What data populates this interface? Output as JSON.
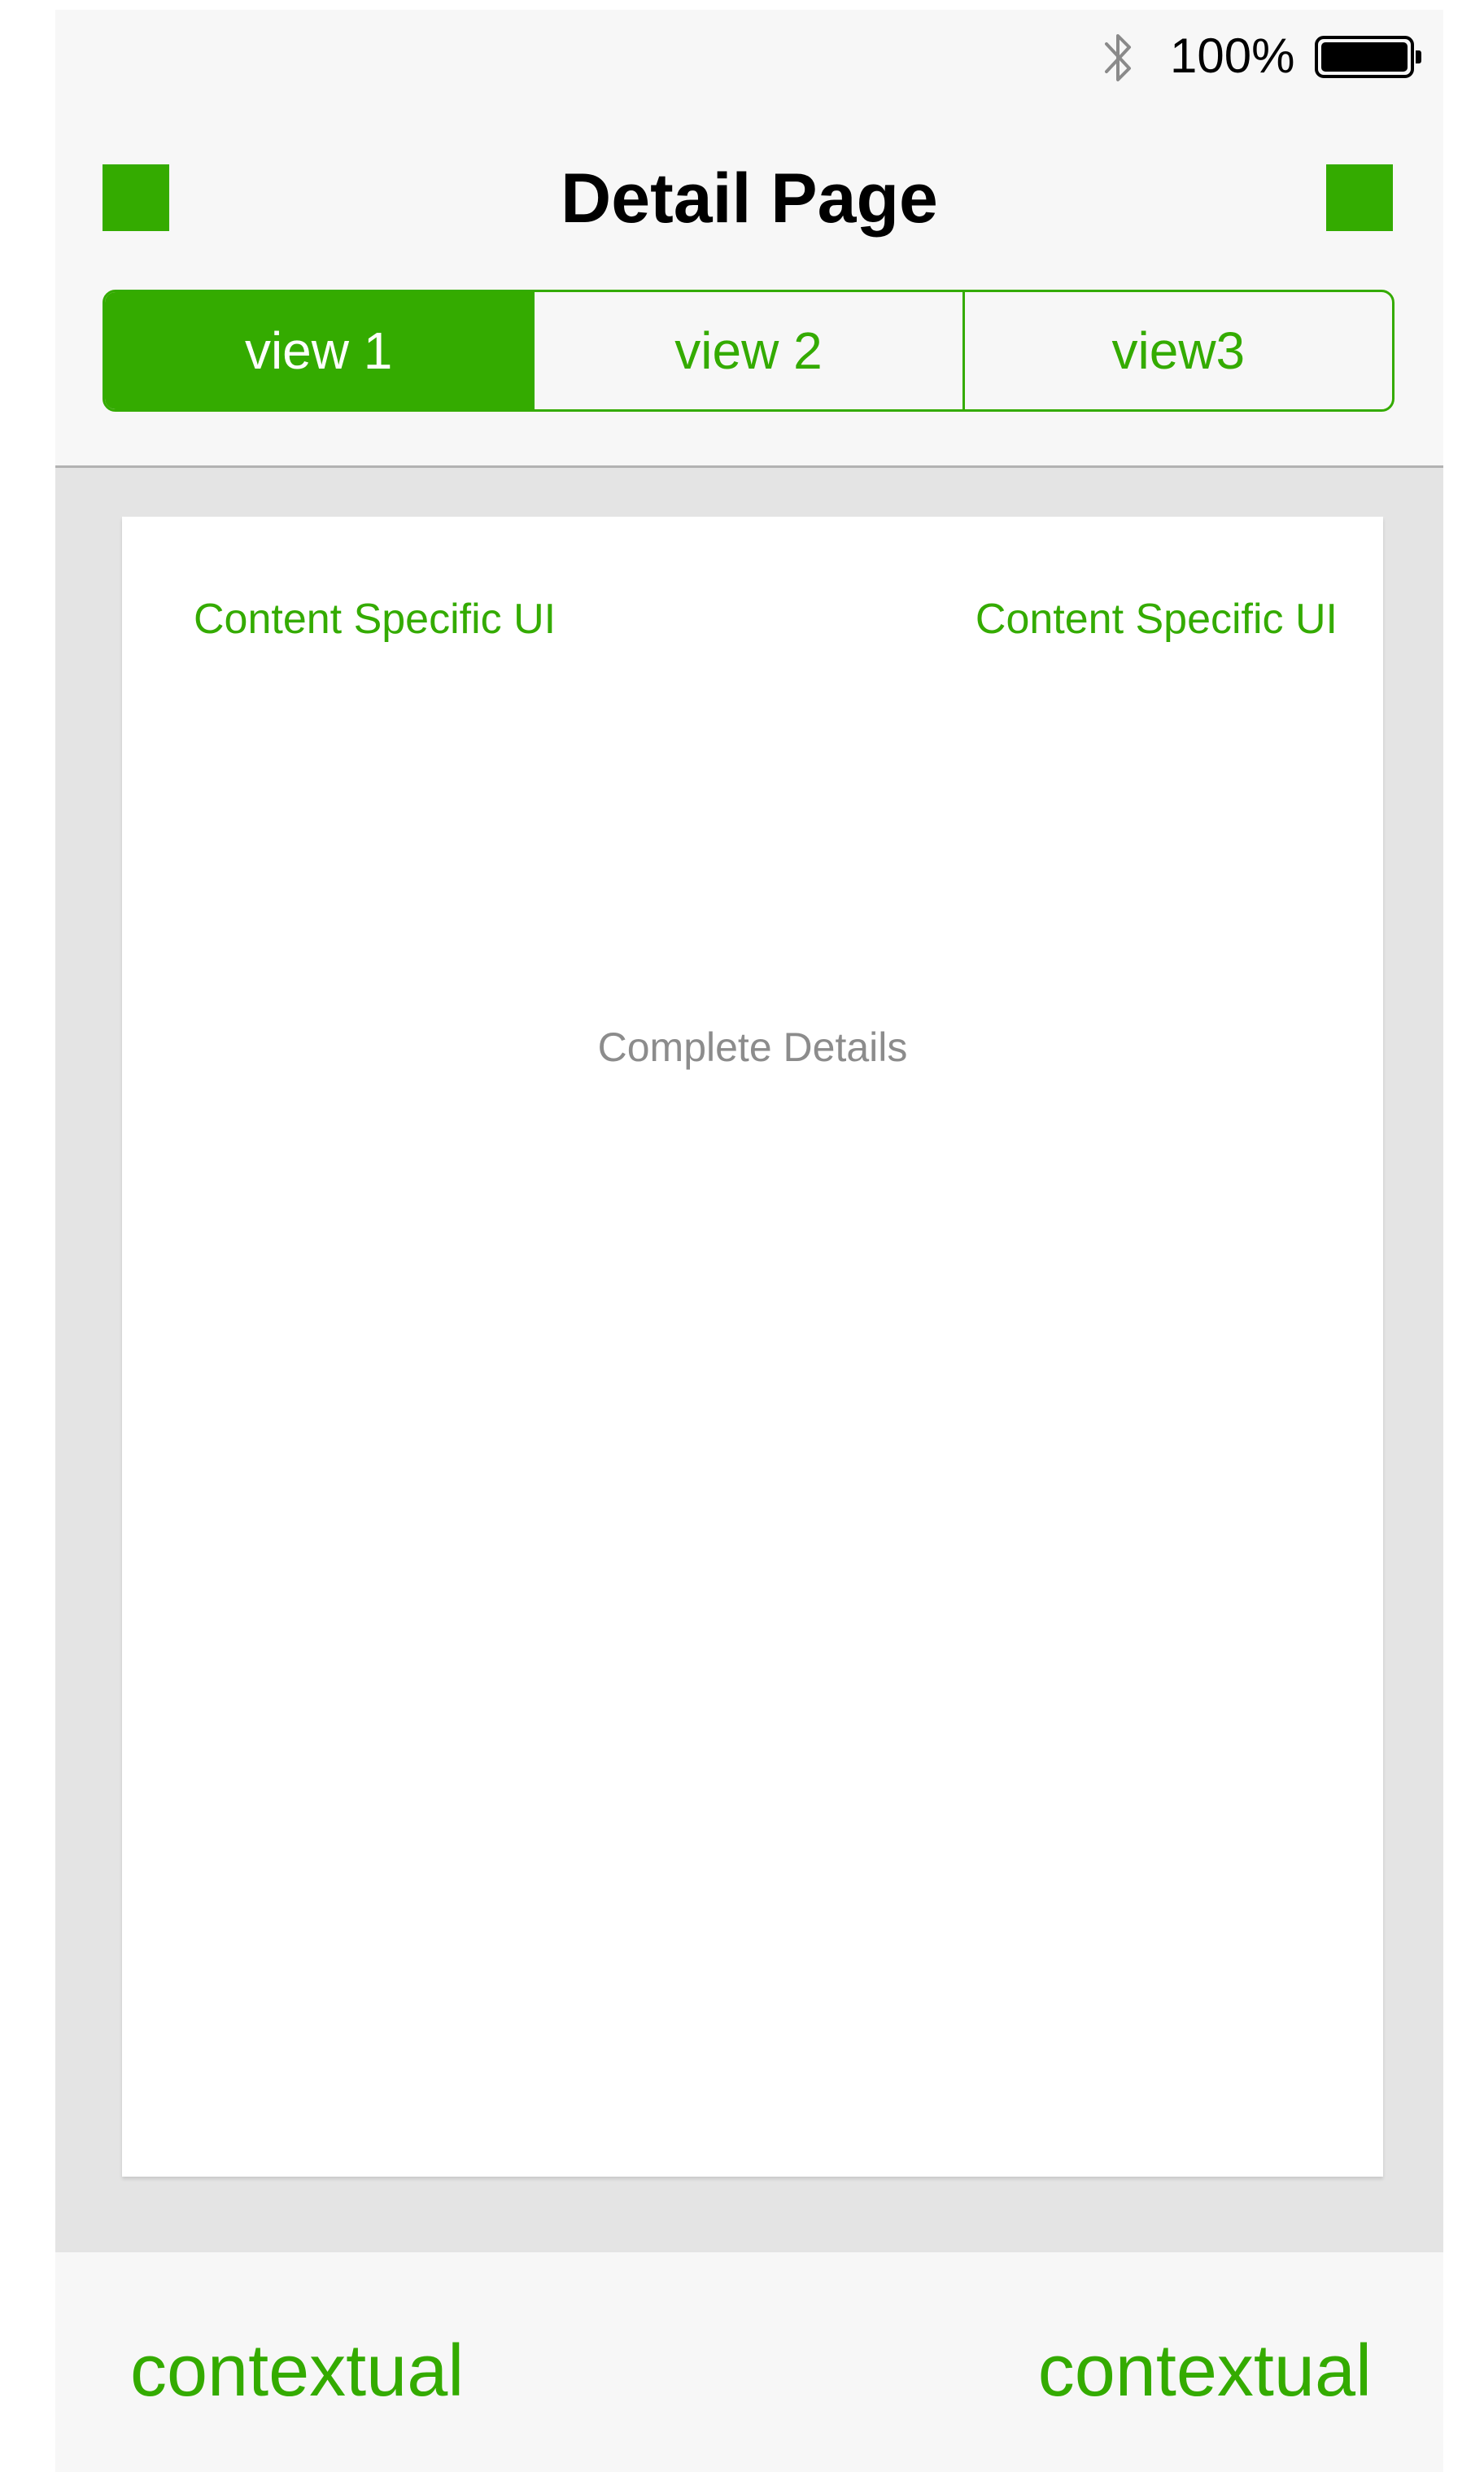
{
  "status_bar": {
    "bluetooth_icon": "bluetooth-icon",
    "battery_percent": "100%",
    "battery_icon": "battery-full-icon"
  },
  "nav_bar": {
    "title": "Detail Page",
    "left_button_icon": "green-square",
    "right_button_icon": "green-square"
  },
  "segmented_control": {
    "segments": [
      {
        "label": "view 1",
        "selected": true
      },
      {
        "label": "view 2",
        "selected": false
      },
      {
        "label": "view3",
        "selected": false
      }
    ]
  },
  "content": {
    "left_ui_label": "Content Specific UI",
    "right_ui_label": "Content Specific UI",
    "details_text": "Complete Details"
  },
  "toolbar": {
    "left_label": "contextual",
    "right_label": "contextual"
  },
  "colors": {
    "accent": "#34ab00",
    "background": "#f7f7f7",
    "content_background": "#e4e4e4",
    "card": "#ffffff",
    "muted_text": "#8c8c8c"
  }
}
